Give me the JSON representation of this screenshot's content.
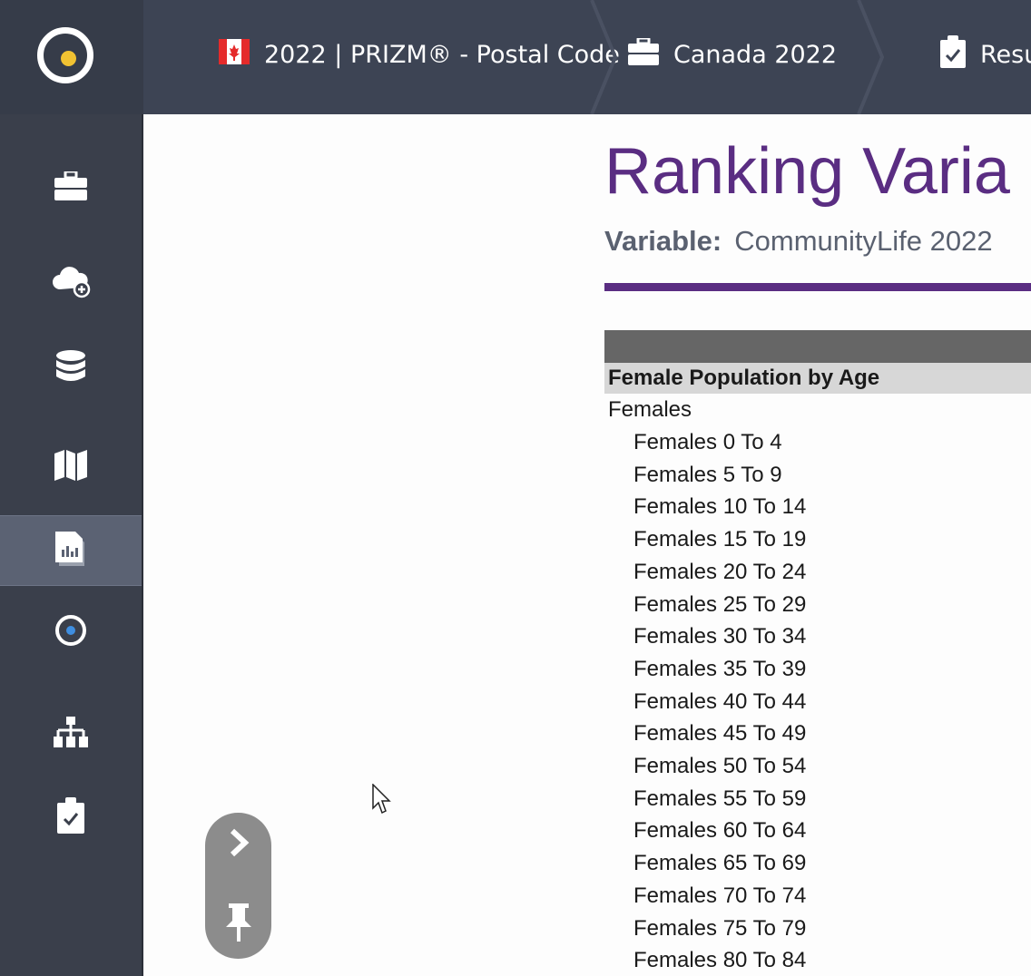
{
  "header": {
    "logo_icon": "claritas-target-logo-icon",
    "crumbs": [
      {
        "icon": "canada-flag-icon",
        "label": "2022 | PRIZM® - Postal Code"
      },
      {
        "icon": "briefcase-icon",
        "label": "Canada 2022"
      },
      {
        "icon": "clipboard-check-icon",
        "label": "Resu"
      }
    ]
  },
  "sidebar": {
    "items": [
      {
        "icon": "briefcase-icon",
        "active": false
      },
      {
        "icon": "cloud-add-icon",
        "active": false
      },
      {
        "icon": "database-icon",
        "active": false
      },
      {
        "icon": "map-icon",
        "active": false
      },
      {
        "icon": "report-chart-icon",
        "active": true
      },
      {
        "icon": "target-icon",
        "active": false
      },
      {
        "icon": "hierarchy-icon",
        "active": false
      },
      {
        "icon": "clipboard-check-icon",
        "active": false
      }
    ]
  },
  "report": {
    "title": "Ranking Varia",
    "variable_key": "Variable:",
    "variable_value": "CommunityLife 2022",
    "group_header": "Female Population by Age",
    "parent_row": "Females",
    "rows": [
      "Females 0 To 4",
      "Females 5 To 9",
      "Females 10 To 14",
      "Females 15 To 19",
      "Females 20 To 24",
      "Females 25 To 29",
      "Females 30 To 34",
      "Females 35 To 39",
      "Females 40 To 44",
      "Females 45 To 49",
      "Females 50 To 54",
      "Females 55 To 59",
      "Females 60 To 64",
      "Females 65 To 69",
      "Females 70 To 74",
      "Females 75 To 79",
      "Females 80 To 84"
    ]
  },
  "panel_handle": {
    "expand_icon": "chevron-right-icon",
    "pin_icon": "pin-icon"
  },
  "colors": {
    "header_bg": "#3d4454",
    "sidebar_bg": "#3a3f4b",
    "accent_purple": "#5a2d82",
    "logo_yellow": "#f1c232"
  }
}
